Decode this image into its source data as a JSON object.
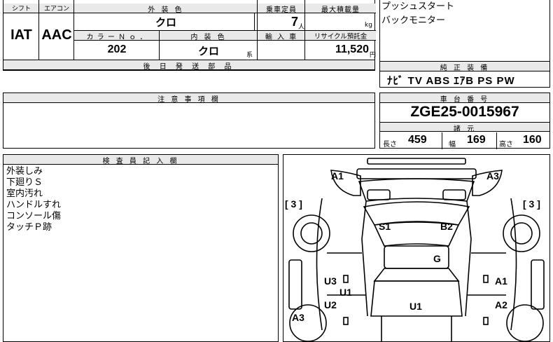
{
  "labels": {
    "shift": "シフト",
    "aircon": "エアコン",
    "exterior_color": "外 装 色",
    "capacity": "乗車定員",
    "max_load": "最大積載量",
    "color_no": "カ ラ ー Ｎ ｏ ．",
    "interior_color": "内 装 色",
    "import": "輸 入 車",
    "recycle": "リサイクル預託金",
    "later_parts": "後 日 発 送 部 品",
    "notes": "注 意 事 項 欄",
    "genuine_equipment": "純 正 装 備",
    "chassis_no": "車 台 番 号",
    "specs": "諸 元",
    "inspector_notes": "検 査 員 記 入 欄",
    "length": "長さ",
    "width": "幅",
    "height": "高さ"
  },
  "vehicle": {
    "shift": "IAT",
    "aircon": "AAC",
    "exterior_color": "クロ",
    "capacity": "7",
    "capacity_unit": "人",
    "max_load_unit": "kg",
    "color_no": "202",
    "interior_color": "クロ",
    "interior_suffix": "系",
    "recycle_amount": "11,520",
    "recycle_unit": "円",
    "chassis_no": "ZGE25-0015967",
    "length": "459",
    "width": "169",
    "height": "160"
  },
  "options": [
    "プッシュスタート",
    "バックモニター"
  ],
  "equipment": "ﾅﾋﾞ TV ABS ｴｱB PS PW",
  "inspector_notes": [
    "外装しみ",
    "下廻りＳ",
    "室内汚れ",
    "ハンドルすれ",
    "コンソール傷",
    "タッチＰ跡"
  ],
  "diagram": {
    "a1_front_left": "A1",
    "a3_front_right": "A3",
    "left_bracket": "[ 3 ]",
    "right_bracket": "[ 3 ]",
    "s1": "S1",
    "b2": "B2",
    "g": "G",
    "u3": "U3",
    "u1_left": "U1",
    "a1_right": "A1",
    "u2": "U2",
    "u1_center": "U1",
    "a2": "A2",
    "a3_rear_left": "A3"
  }
}
